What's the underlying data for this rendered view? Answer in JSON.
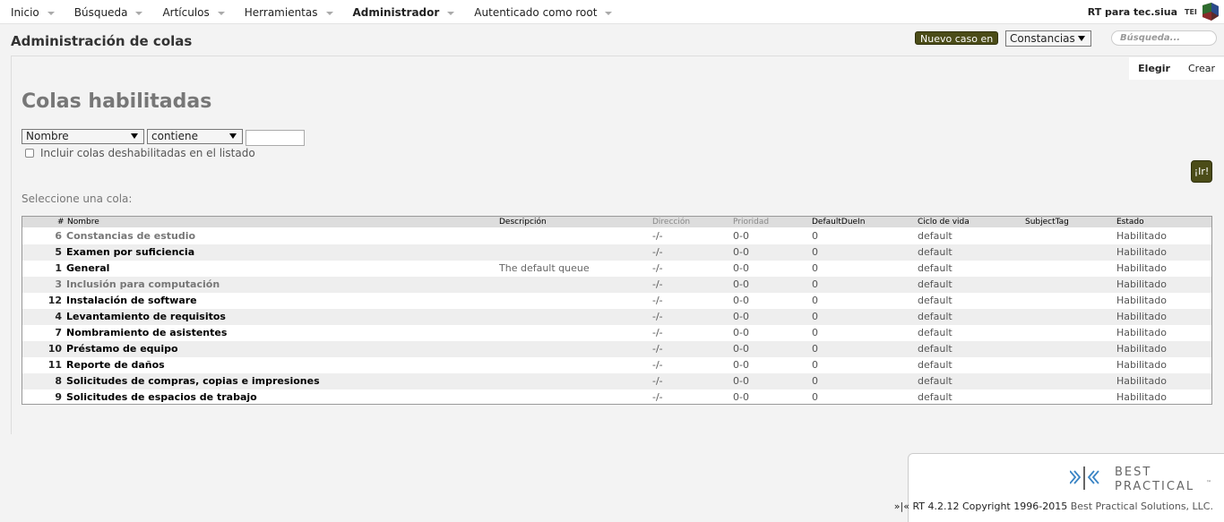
{
  "nav": {
    "items": [
      {
        "label": "Inicio",
        "bold": false
      },
      {
        "label": "Búsqueda",
        "bold": false
      },
      {
        "label": "Artículos",
        "bold": false
      },
      {
        "label": "Herramientas",
        "bold": false
      },
      {
        "label": "Administrador",
        "bold": true
      },
      {
        "label": "Autenticado como root",
        "bold": false
      }
    ],
    "site_name": "RT para tec.siua",
    "logo_text": "TEI"
  },
  "header": {
    "page_title": "Administración de colas",
    "new_case_label": "Nuevo caso en",
    "queue_selected": "Constancias",
    "search_placeholder": "Búsqueda..."
  },
  "tabs": [
    {
      "label": "Elegir",
      "active": true
    },
    {
      "label": "Crear",
      "active": false
    }
  ],
  "section_title": "Colas habilitadas",
  "filter": {
    "field_selected": "Nombre",
    "op_selected": "contiene",
    "value": "",
    "include_disabled_label": "Incluir colas deshabilitadas en el listado",
    "include_disabled_checked": false,
    "go_label": "¡Ir!"
  },
  "choose_label": "Seleccione una cola:",
  "table": {
    "columns": [
      "#",
      "Nombre",
      "Descripción",
      "Dirección",
      "Prioridad",
      "DefaultDueIn",
      "Ciclo de vida",
      "SubjectTag",
      "Estado"
    ],
    "rows": [
      {
        "id": "6",
        "name": "Constancias de estudio",
        "desc": "",
        "addr": "-/-",
        "prio": "0-0",
        "due": "0",
        "life": "default",
        "tag": "",
        "status": "Habilitado",
        "dim": true
      },
      {
        "id": "5",
        "name": "Examen por suficiencia",
        "desc": "",
        "addr": "-/-",
        "prio": "0-0",
        "due": "0",
        "life": "default",
        "tag": "",
        "status": "Habilitado",
        "dim": false
      },
      {
        "id": "1",
        "name": "General",
        "desc": "The default queue",
        "addr": "-/-",
        "prio": "0-0",
        "due": "0",
        "life": "default",
        "tag": "",
        "status": "Habilitado",
        "dim": false
      },
      {
        "id": "3",
        "name": "Inclusión para computación",
        "desc": "",
        "addr": "-/-",
        "prio": "0-0",
        "due": "0",
        "life": "default",
        "tag": "",
        "status": "Habilitado",
        "dim": true
      },
      {
        "id": "12",
        "name": "Instalación de software",
        "desc": "",
        "addr": "-/-",
        "prio": "0-0",
        "due": "0",
        "life": "default",
        "tag": "",
        "status": "Habilitado",
        "dim": false
      },
      {
        "id": "4",
        "name": "Levantamiento de requisitos",
        "desc": "",
        "addr": "-/-",
        "prio": "0-0",
        "due": "0",
        "life": "default",
        "tag": "",
        "status": "Habilitado",
        "dim": false
      },
      {
        "id": "7",
        "name": "Nombramiento de asistentes",
        "desc": "",
        "addr": "-/-",
        "prio": "0-0",
        "due": "0",
        "life": "default",
        "tag": "",
        "status": "Habilitado",
        "dim": false
      },
      {
        "id": "10",
        "name": "Préstamo de equipo",
        "desc": "",
        "addr": "-/-",
        "prio": "0-0",
        "due": "0",
        "life": "default",
        "tag": "",
        "status": "Habilitado",
        "dim": false
      },
      {
        "id": "11",
        "name": "Reporte de daños",
        "desc": "",
        "addr": "-/-",
        "prio": "0-0",
        "due": "0",
        "life": "default",
        "tag": "",
        "status": "Habilitado",
        "dim": false
      },
      {
        "id": "8",
        "name": "Solicitudes de compras, copias e impresiones",
        "desc": "",
        "addr": "-/-",
        "prio": "0-0",
        "due": "0",
        "life": "default",
        "tag": "",
        "status": "Habilitado",
        "dim": false
      },
      {
        "id": "9",
        "name": "Solicitudes de espacios de trabajo",
        "desc": "",
        "addr": "-/-",
        "prio": "0-0",
        "due": "0",
        "life": "default",
        "tag": "",
        "status": "Habilitado",
        "dim": false
      }
    ]
  },
  "footer": {
    "logo_line1": "BEST",
    "logo_line2": "PRACTICAL",
    "logo_tm": "™",
    "copyright_prefix": "»|« RT 4.2.12 Copyright 1996-2015",
    "copyright_link": "Best Practical Solutions, LLC."
  },
  "colors": {
    "accent": "#4b4c18",
    "header_bg": "#dddddd",
    "alt_row": "#eeeeee"
  }
}
